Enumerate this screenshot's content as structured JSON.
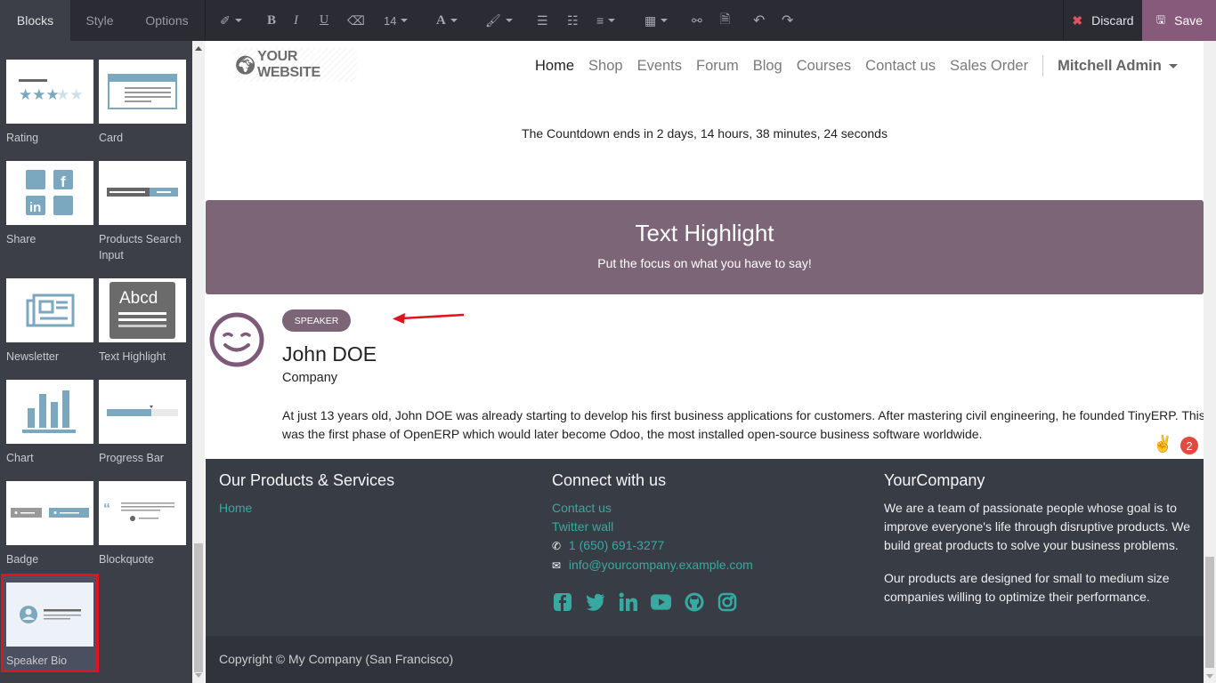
{
  "sidebar": {
    "tabs": [
      {
        "label": "Blocks",
        "active": true
      },
      {
        "label": "Style",
        "active": false
      },
      {
        "label": "Options",
        "active": false
      }
    ],
    "snippets": [
      {
        "label": "Rating",
        "icon": "rating-icon"
      },
      {
        "label": "Card",
        "icon": "card-icon"
      },
      {
        "label": "Share",
        "icon": "share-icon"
      },
      {
        "label": "Products Search Input",
        "icon": "search-input-icon"
      },
      {
        "label": "Newsletter",
        "icon": "newsletter-icon"
      },
      {
        "label": "Text Highlight",
        "icon": "text-highlight-icon"
      },
      {
        "label": "Chart",
        "icon": "chart-icon"
      },
      {
        "label": "Progress Bar",
        "icon": "progress-bar-icon"
      },
      {
        "label": "Badge",
        "icon": "badge-icon"
      },
      {
        "label": "Blockquote",
        "icon": "blockquote-icon"
      },
      {
        "label": "Speaker Bio",
        "icon": "speaker-bio-icon",
        "selected": true
      }
    ]
  },
  "toolbar": {
    "font_size": "14",
    "discard_label": "Discard",
    "save_label": "Save",
    "colors": {
      "save_bg": "#875a7b",
      "discard_icon": "#e05260"
    }
  },
  "header": {
    "logo_text": "YOUR WEBSITE",
    "nav": [
      {
        "label": "Home",
        "active": true
      },
      {
        "label": "Shop"
      },
      {
        "label": "Events"
      },
      {
        "label": "Forum"
      },
      {
        "label": "Blog"
      },
      {
        "label": "Courses"
      },
      {
        "label": "Contact us"
      },
      {
        "label": "Sales Order"
      }
    ],
    "user": "Mitchell Admin"
  },
  "countdown_text": "The Countdown ends in 2 days, 14 hours, 38 minutes, 24 seconds",
  "highlight": {
    "title": "Text Highlight",
    "subtitle": "Put the focus on what you have to say!",
    "color": "#7c6576"
  },
  "speaker": {
    "badge": "SPEAKER",
    "name": "John DOE",
    "company": "Company",
    "bio": "At just 13 years old, John DOE was already starting to develop his first business applications for customers. After mastering civil engineering, he founded TinyERP. This was the first phase of OpenERP which would later become Odoo, the most installed open-source business software worldwide.",
    "notification_count": "2"
  },
  "footer": {
    "col1": {
      "title": "Our Products & Services",
      "links": [
        "Home"
      ]
    },
    "col2": {
      "title": "Connect with us",
      "links": [
        "Contact us",
        "Twitter wall"
      ],
      "phone": "1 (650) 691-3277",
      "email": "info@yourcompany.example.com",
      "socials": [
        "facebook-icon",
        "twitter-icon",
        "linkedin-icon",
        "youtube-icon",
        "github-icon",
        "instagram-icon"
      ]
    },
    "col3": {
      "title": "YourCompany",
      "p1": "We are a team of passionate people whose goal is to improve everyone's life through disruptive products. We build great products to solve your business problems.",
      "p2": "Our products are designed for small to medium size companies willing to optimize their performance."
    },
    "copyright": "Copyright © My Company (San Francisco)",
    "link_color": "#37a9a0"
  }
}
